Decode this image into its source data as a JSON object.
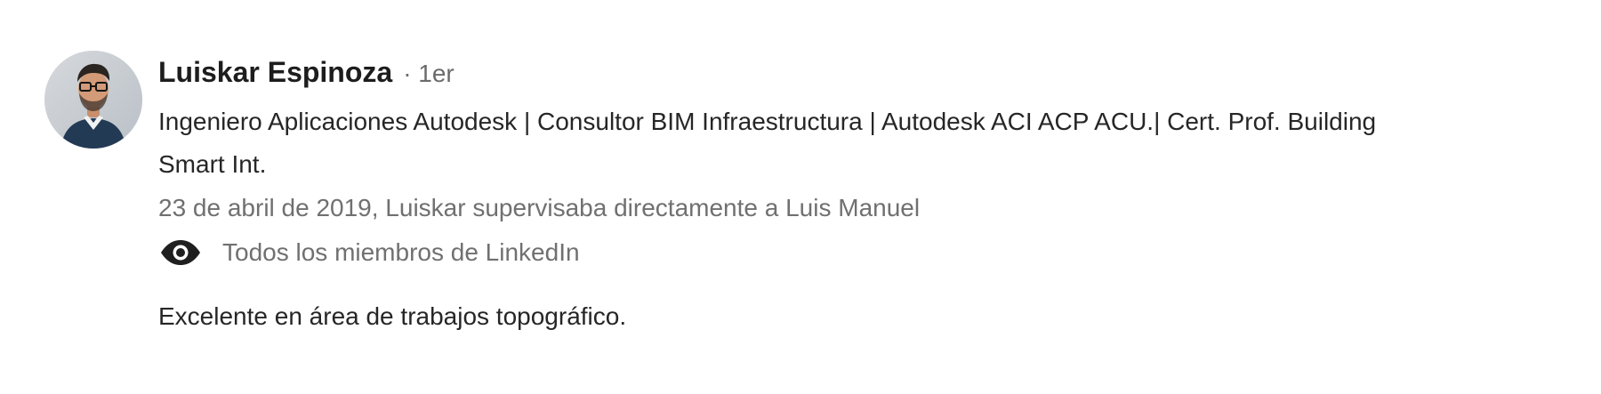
{
  "recommender": {
    "name": "Luiskar Espinoza",
    "degree": "· 1er",
    "headline": "Ingeniero Aplicaciones Autodesk | Consultor BIM Infraestructura | Autodesk ACI ACP ACU.| Cert. Prof. Building Smart Int.",
    "avatar_icon": "profile-photo-icon"
  },
  "meta": {
    "date_relation": "23 de abril de 2019, Luiskar supervisaba directamente a Luis Manuel"
  },
  "visibility": {
    "icon": "eye-icon",
    "label": "Todos los miembros de LinkedIn"
  },
  "recommendation": {
    "text": "Excelente en área de trabajos topográfico."
  },
  "colors": {
    "primary_text": "#262626",
    "secondary_text": "#707070",
    "background": "#ffffff"
  }
}
